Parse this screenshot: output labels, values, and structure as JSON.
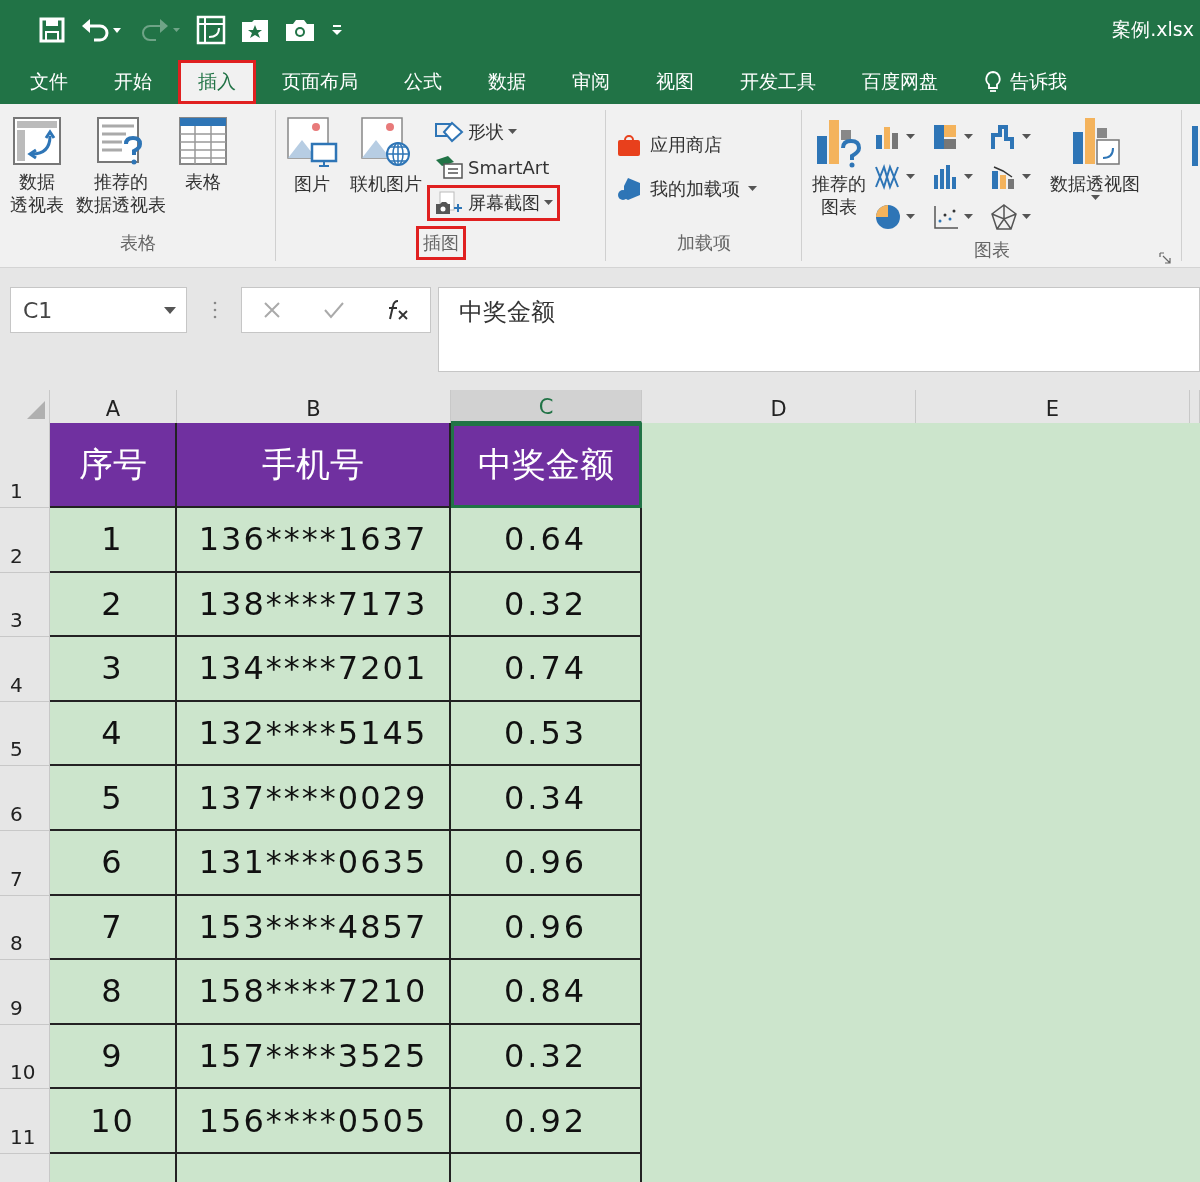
{
  "title_bar": {
    "title": "案例.xlsx"
  },
  "tabs": [
    {
      "label": "文件",
      "selected": false,
      "highlighted": false
    },
    {
      "label": "开始",
      "selected": false,
      "highlighted": false
    },
    {
      "label": "插入",
      "selected": true,
      "highlighted": true
    },
    {
      "label": "页面布局",
      "selected": false,
      "highlighted": false
    },
    {
      "label": "公式",
      "selected": false,
      "highlighted": false
    },
    {
      "label": "数据",
      "selected": false,
      "highlighted": false
    },
    {
      "label": "审阅",
      "selected": false,
      "highlighted": false
    },
    {
      "label": "视图",
      "selected": false,
      "highlighted": false
    },
    {
      "label": "开发工具",
      "selected": false,
      "highlighted": false
    },
    {
      "label": "百度网盘",
      "selected": false,
      "highlighted": false
    }
  ],
  "tell_me": {
    "label": "告诉我"
  },
  "ribbon": {
    "groups": [
      {
        "label": "表格",
        "highlighted": false,
        "buttons": [
          [
            "数据",
            "透视表"
          ],
          [
            "推荐的",
            "数据透视表"
          ],
          [
            "表格"
          ]
        ]
      },
      {
        "label": "插图",
        "highlighted": true,
        "buttons": [
          [
            "图片"
          ],
          [
            "联机图片"
          ]
        ],
        "small_buttons": [
          {
            "label": "形状",
            "dropdown": true,
            "highlighted": false
          },
          {
            "label": "SmartArt",
            "dropdown": false,
            "highlighted": false
          },
          {
            "label": "屏幕截图",
            "dropdown": true,
            "highlighted": true
          }
        ]
      },
      {
        "label": "加载项",
        "highlighted": false,
        "small_buttons": [
          {
            "label": "应用商店",
            "dropdown": false,
            "highlighted": false
          },
          {
            "label": "我的加载项",
            "dropdown": true,
            "highlighted": false
          }
        ]
      },
      {
        "label": "图表",
        "highlighted": false,
        "buttons": [
          [
            "推荐的",
            "图表"
          ],
          [
            "数据透视图"
          ]
        ]
      }
    ]
  },
  "formula_bar": {
    "name_box": "C1",
    "formula": "中奖金额"
  },
  "sheet": {
    "columns": [
      {
        "label": "A",
        "selected": false
      },
      {
        "label": "B",
        "selected": false
      },
      {
        "label": "C",
        "selected": true
      },
      {
        "label": "D",
        "selected": false
      },
      {
        "label": "E",
        "selected": false
      }
    ],
    "header": {
      "row": "1",
      "cells": [
        "序号",
        "手机号",
        "中奖金额"
      ]
    },
    "rows": [
      {
        "row": "2",
        "cells": [
          "1",
          "136****1637",
          "0.64"
        ]
      },
      {
        "row": "3",
        "cells": [
          "2",
          "138****7173",
          "0.32"
        ]
      },
      {
        "row": "4",
        "cells": [
          "3",
          "134****7201",
          "0.74"
        ]
      },
      {
        "row": "5",
        "cells": [
          "4",
          "132****5145",
          "0.53"
        ]
      },
      {
        "row": "6",
        "cells": [
          "5",
          "137****0029",
          "0.34"
        ]
      },
      {
        "row": "7",
        "cells": [
          "6",
          "131****0635",
          "0.96"
        ]
      },
      {
        "row": "8",
        "cells": [
          "7",
          "153****4857",
          "0.96"
        ]
      },
      {
        "row": "9",
        "cells": [
          "8",
          "158****7210",
          "0.84"
        ]
      },
      {
        "row": "10",
        "cells": [
          "9",
          "157****3525",
          "0.32"
        ]
      },
      {
        "row": "11",
        "cells": [
          "10",
          "156****0505",
          "0.92"
        ]
      }
    ]
  }
}
